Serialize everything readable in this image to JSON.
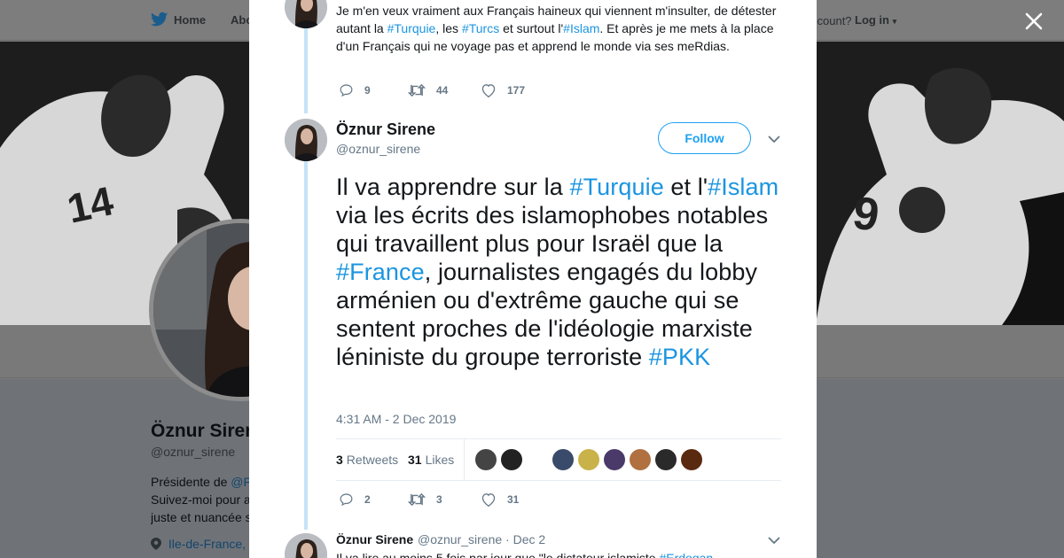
{
  "nav": {
    "home": "Home",
    "about": "Abo",
    "account": "ccount?",
    "login": "Log in"
  },
  "profile": {
    "name": "Öznur Siren",
    "handle": "@oznur_sirene",
    "bio_line1_prefix": "Présidente de ",
    "bio_line1_link": "@F",
    "bio_line2": "Suivez-moi pour a",
    "bio_line3": "juste et nuancée s",
    "location": "Ile-de-France,"
  },
  "previous_tweet": {
    "segments": [
      {
        "text": "Je m'en veux vraiment aux Français haineux qui viennent m'insulter, de détester autant la ",
        "tag": false
      },
      {
        "text": "#Turquie",
        "tag": true
      },
      {
        "text": ", les ",
        "tag": false
      },
      {
        "text": "#Turcs",
        "tag": true
      },
      {
        "text": " et surtout l'",
        "tag": false
      },
      {
        "text": "#Islam",
        "tag": true
      },
      {
        "text": ". Et après je me mets à la place d'un Français qui ne voyage pas et apprend le monde via ses meRdias.",
        "tag": false
      }
    ],
    "replies": "9",
    "retweets": "44",
    "likes": "177"
  },
  "main_tweet": {
    "name": "Öznur Sirene",
    "handle": "@oznur_sirene",
    "follow_label": "Follow",
    "segments": [
      {
        "text": "Il va apprendre sur la ",
        "tag": false
      },
      {
        "text": "#Turquie",
        "tag": true
      },
      {
        "text": " et l'",
        "tag": false
      },
      {
        "text": "#Islam",
        "tag": true
      },
      {
        "text": " via les écrits des islamophobes notables qui travaillent plus pour Israël que la ",
        "tag": false
      },
      {
        "text": "#France",
        "tag": true
      },
      {
        "text": ", journalistes engagés du lobby arménien ou d'extrême gauche qui se sentent proches de l'idéologie marxiste léniniste du groupe terroriste ",
        "tag": false
      },
      {
        "text": "#PKK",
        "tag": true
      }
    ],
    "timestamp": "4:31 AM - 2 Dec 2019",
    "retweet_count": "3",
    "retweet_label": "Retweets",
    "like_count": "31",
    "like_label": "Likes",
    "replies": "2",
    "retweets": "3",
    "likes": "31"
  },
  "reply_tweet": {
    "name": "Öznur Sirene",
    "handle": "@oznur_sirene",
    "date": "Dec 2",
    "text_prefix": "Il va lire au moins 5 fois par jour que \"le dictateur islamiste ",
    "text_tag": "#Erdogan"
  },
  "colors": {
    "accent": "#1da1f2",
    "hashtag": "#1b95e0",
    "thread_line": "#c4e3f6",
    "secondary_text": "#657786"
  },
  "likers": [
    "#444",
    "#222",
    "#fff",
    "#3a4a6a",
    "#c9b24a",
    "#4a3a6a",
    "#b07040",
    "#2a2a2a",
    "#5a2a10"
  ]
}
